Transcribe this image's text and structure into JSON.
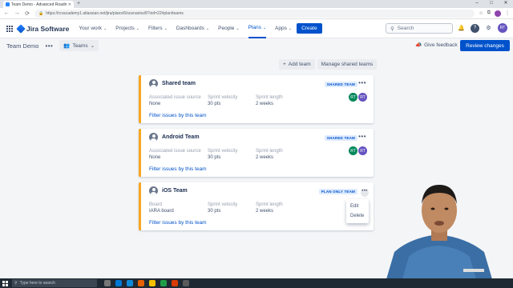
{
  "browser": {
    "tab_title": "Team Demo - Advanced Roadm",
    "url": "https://rcvacademy1.atlassian.net/jira/plans/6/scenarios/8?vid=22#plan/teams"
  },
  "header": {
    "product": "Jira Software",
    "nav": [
      {
        "label": "Your work",
        "active": false
      },
      {
        "label": "Projects",
        "active": false
      },
      {
        "label": "Filters",
        "active": false
      },
      {
        "label": "Dashboards",
        "active": false
      },
      {
        "label": "People",
        "active": false
      },
      {
        "label": "Plans",
        "active": true
      },
      {
        "label": "Apps",
        "active": false
      }
    ],
    "create_label": "Create",
    "search_placeholder": "Search",
    "user_initials": "RT"
  },
  "subheader": {
    "plan_name": "Team Demo",
    "view_label": "Teams",
    "feedback_label": "Give feedback",
    "review_label": "Review changes"
  },
  "actions": {
    "add_team": "Add team",
    "manage_shared": "Manage shared teams"
  },
  "field_labels": {
    "source": "Associated issue source",
    "velocity": "Sprint velocity",
    "length": "Sprint length",
    "board": "Board",
    "filter_link": "Filter issues by this team"
  },
  "teams": [
    {
      "name": "Shared team",
      "badge": "SHARED TEAM",
      "source": "None",
      "velocity": "30 pts",
      "length": "2 weeks",
      "members": [
        "RT",
        "RT"
      ]
    },
    {
      "name": "Android Team",
      "badge": "SHARED TEAM",
      "source": "None",
      "velocity": "30 pts",
      "length": "2 weeks",
      "members": [
        "RT",
        "RT"
      ]
    },
    {
      "name": "iOS Team",
      "badge": "PLAN ONLY TEAM",
      "source": "IARA board",
      "velocity": "30 pts",
      "length": "2 weeks",
      "members": []
    }
  ],
  "context_menu": {
    "edit": "Edit",
    "delete": "Delete"
  },
  "taskbar": {
    "search_placeholder": "Type here to search"
  },
  "colors": {
    "primary": "#0052cc",
    "team_accent": "#f6a623",
    "member_green": "#00875a",
    "member_purple": "#6554c0"
  }
}
